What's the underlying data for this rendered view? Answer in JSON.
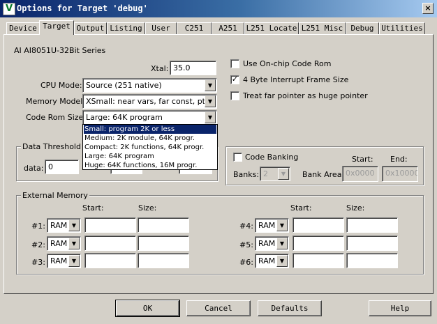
{
  "window": {
    "title": "Options for Target 'debug'",
    "logo": "V",
    "close": "×"
  },
  "tabs": [
    "Device",
    "Target",
    "Output",
    "Listing",
    "User",
    "C251",
    "A251",
    "L251 Locate",
    "L251 Misc",
    "Debug",
    "Utilities"
  ],
  "active_tab": "Target",
  "device_name": "AI AI8051U-32Bit Series",
  "xtal": {
    "label": "Xtal:",
    "value": "35.0"
  },
  "cpu_mode": {
    "label": "CPU Mode:",
    "value": "Source (251 native)"
  },
  "memory_model": {
    "label": "Memory Model:",
    "value": "XSmall: near vars, far const, ptr-4"
  },
  "code_rom_size": {
    "label": "Code Rom Size:",
    "value": "Large: 64K program",
    "options": [
      "Small: program 2K or less",
      "Medium: 2K module, 64K progr.",
      "Compact: 2K functions, 64K progr.",
      "Large: 64K program",
      "Huge: 64K functions, 16M progr."
    ],
    "highlighted": "Small: program 2K or less"
  },
  "options": {
    "onchip_code_rom": {
      "label": "Use On-chip Code Rom",
      "checked": false
    },
    "four_byte_irq": {
      "label": "4 Byte Interrupt Frame Size",
      "checked": true
    },
    "far_huge": {
      "label": "Treat far pointer as huge pointer",
      "checked": false
    }
  },
  "data_threshold": {
    "title": "Data Threshold",
    "data_label": "data:",
    "data_value": "0"
  },
  "code_banking": {
    "label": "Code Banking",
    "checked": false,
    "start_label": "Start:",
    "end_label": "End:",
    "banks_label": "Banks:",
    "banks_value": "2",
    "bank_area_label": "Bank Area:",
    "start_value": "0x0000",
    "end_value": "0x10000"
  },
  "external_memory": {
    "title": "External Memory",
    "start_label": "Start:",
    "size_label": "Size:",
    "rows": [
      {
        "label": "#1:",
        "type": "RAM"
      },
      {
        "label": "#2:",
        "type": "RAM"
      },
      {
        "label": "#3:",
        "type": "RAM"
      },
      {
        "label": "#4:",
        "type": "RAM"
      },
      {
        "label": "#5:",
        "type": "RAM"
      },
      {
        "label": "#6:",
        "type": "RAM"
      }
    ]
  },
  "buttons": {
    "ok": "OK",
    "cancel": "Cancel",
    "defaults": "Defaults",
    "help": "Help"
  },
  "icons": {
    "dropdown": "▼",
    "check": "✓"
  }
}
